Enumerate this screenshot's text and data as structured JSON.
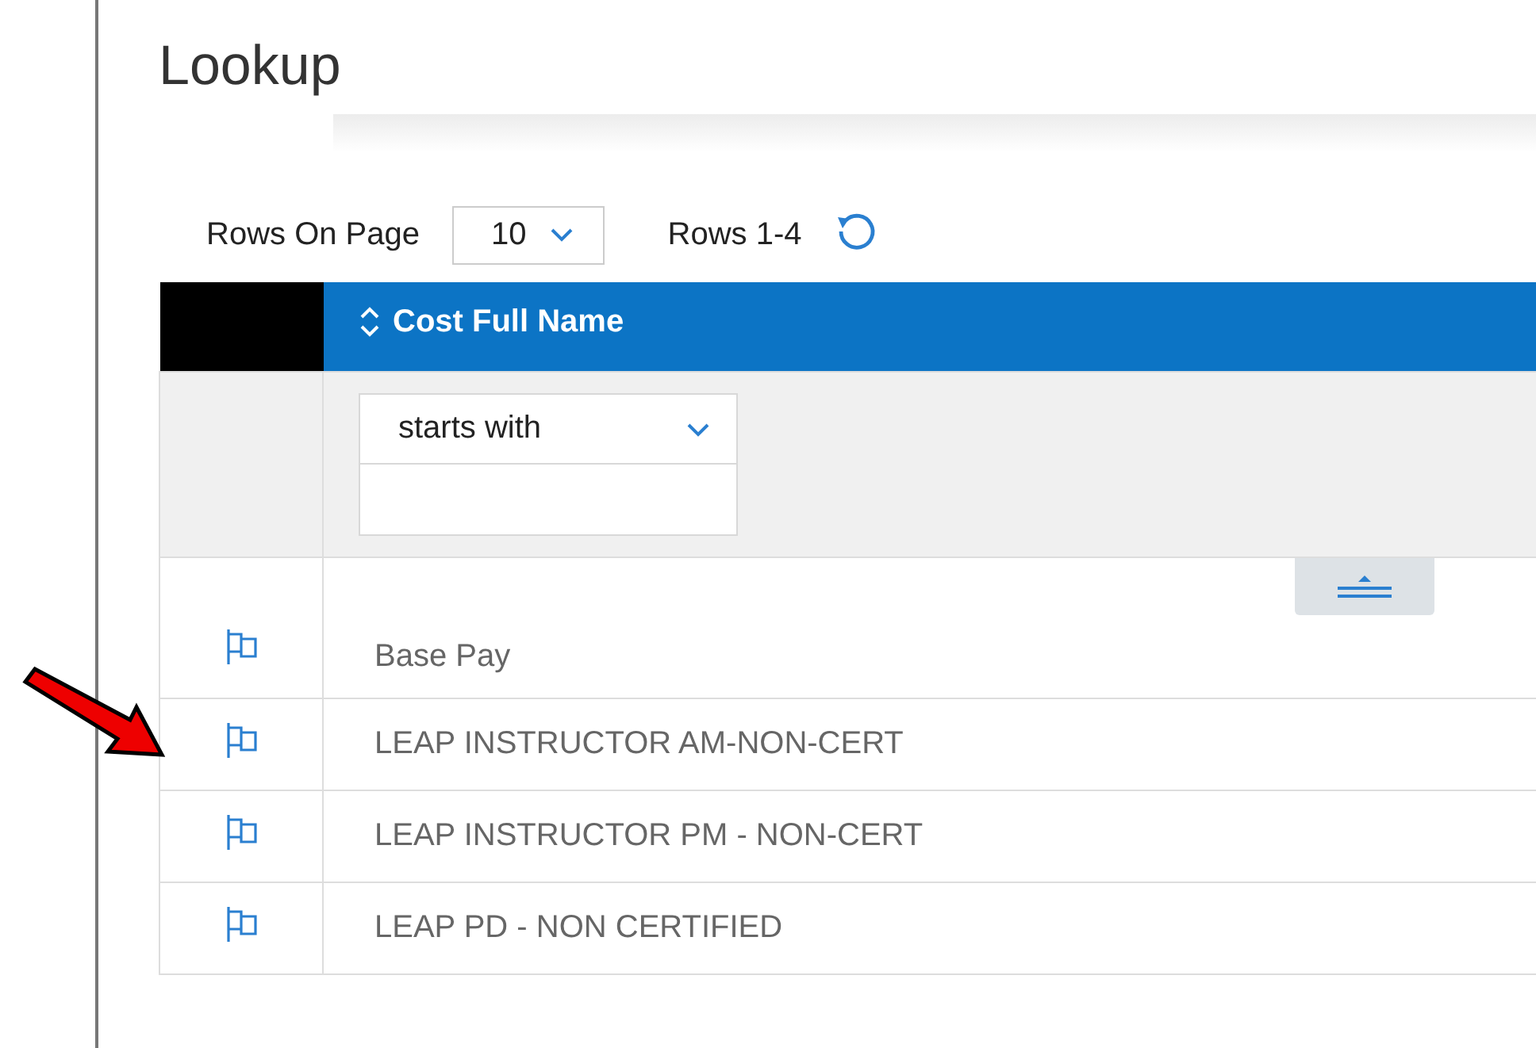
{
  "title": "Lookup",
  "toolbar": {
    "rows_on_page_label": "Rows On Page",
    "rows_on_page_value": "10",
    "rows_range": "Rows 1-4"
  },
  "table": {
    "columns": [
      "Cost Full Name"
    ],
    "filter": {
      "operator": "starts with"
    },
    "rows": [
      {
        "cost_full_name": "Base Pay"
      },
      {
        "cost_full_name": "LEAP INSTRUCTOR AM-NON-CERT"
      },
      {
        "cost_full_name": "LEAP INSTRUCTOR PM - NON-CERT"
      },
      {
        "cost_full_name": "LEAP PD - NON CERTIFIED"
      }
    ]
  }
}
